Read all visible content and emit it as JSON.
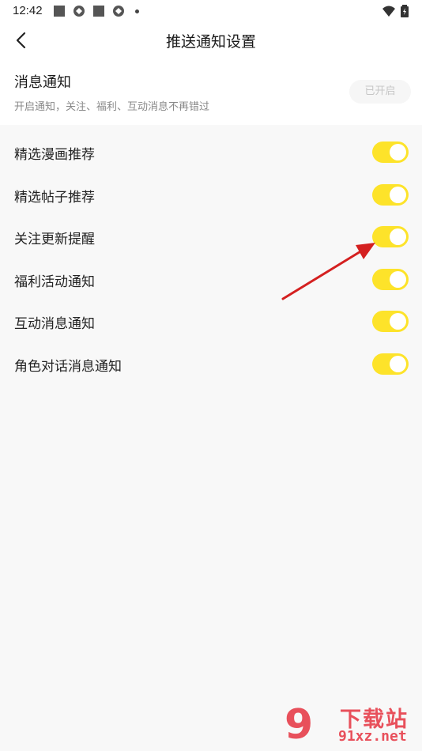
{
  "status_bar": {
    "time": "12:42",
    "icons": [
      "square-icon",
      "cloud-sync-icon",
      "square-icon",
      "cloud-sync-icon",
      "dot-icon",
      "wifi-icon",
      "battery-charging-icon"
    ]
  },
  "nav": {
    "back_icon": "chevron-left-icon",
    "title": "推送通知设置"
  },
  "master": {
    "title": "消息通知",
    "description": "开启通知，关注、福利、互动消息不再错过",
    "status_label": "已开启"
  },
  "settings": [
    {
      "label": "精选漫画推荐",
      "enabled": true
    },
    {
      "label": "精选帖子推荐",
      "enabled": true
    },
    {
      "label": "关注更新提醒",
      "enabled": true
    },
    {
      "label": "福利活动通知",
      "enabled": true
    },
    {
      "label": "互动消息通知",
      "enabled": true
    },
    {
      "label": "角色对话消息通知",
      "enabled": true
    }
  ],
  "watermark": {
    "mark": "9",
    "text": "下载站",
    "url": "91xz.net"
  },
  "colors": {
    "accent": "#fde32a",
    "arrow": "#d42020",
    "watermark": "#e8505b",
    "background": "#f8f8f8"
  }
}
